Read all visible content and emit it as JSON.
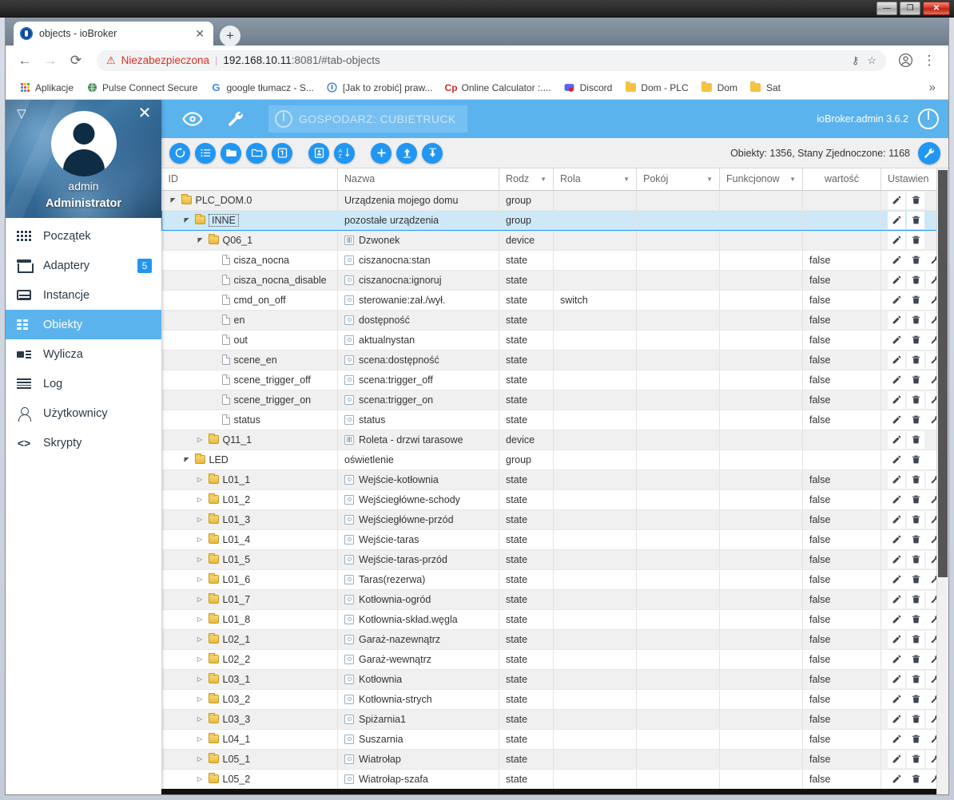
{
  "window": {
    "minimize_label": "—",
    "maximize_label": "❐",
    "close_label": "✕"
  },
  "browser": {
    "tab": {
      "title": "objects - ioBroker",
      "close_label": "✕"
    },
    "new_tab_label": "+",
    "nav": {
      "back": "←",
      "forward": "→",
      "reload": "⟳"
    },
    "omnibox": {
      "warning_icon": "⚠",
      "security_text": "Niezabezpieczona",
      "separator": "|",
      "url_host": "192.168.10.11",
      "url_rest": ":8081/#tab-objects",
      "key_icon": "⚷",
      "star_icon": "☆"
    },
    "profile_icon": "●",
    "menu_icon": "⋮",
    "bookmarks": [
      {
        "label": "Aplikacje",
        "icon": "apps-grid-icon"
      },
      {
        "label": "Pulse Connect Secure",
        "icon": "globe-icon"
      },
      {
        "label": "google tłumacz - S...",
        "icon": "google-icon"
      },
      {
        "label": "[Jak to zrobić] praw...",
        "icon": "info-icon"
      },
      {
        "label": "Online Calculator :....",
        "icon": "calculator-icon"
      },
      {
        "label": "Discord",
        "icon": "discord-icon"
      },
      {
        "label": "Dom - PLC",
        "icon": "folder-icon"
      },
      {
        "label": "Dom",
        "icon": "folder-icon"
      },
      {
        "label": "Sat",
        "icon": "folder-icon"
      }
    ],
    "bookmarks_overflow": "»"
  },
  "sidebar": {
    "caret_icon": "▽",
    "close_icon": "✕",
    "user_name": "admin",
    "user_role": "Administrator",
    "items": [
      {
        "label": "Początek",
        "icon": "apps-icon",
        "badge": "",
        "active": false
      },
      {
        "label": "Adaptery",
        "icon": "store-icon",
        "badge": "5",
        "active": false
      },
      {
        "label": "Instancje",
        "icon": "instances-icon",
        "badge": "",
        "active": false
      },
      {
        "label": "Obiekty",
        "icon": "list-icon",
        "badge": "",
        "active": true
      },
      {
        "label": "Wylicza",
        "icon": "enum-icon",
        "badge": "",
        "active": false
      },
      {
        "label": "Log",
        "icon": "log-icon",
        "badge": "",
        "active": false
      },
      {
        "label": "Użytkownicy",
        "icon": "user-icon",
        "badge": "",
        "active": false
      },
      {
        "label": "Skrypty",
        "icon": "code-icon",
        "badge": "",
        "active": false
      }
    ]
  },
  "appbar": {
    "eye_icon": "eye-icon",
    "wrench_icon": "wrench-icon",
    "host_badge": "GOSPODARZ: CUBIETRUCK",
    "version": "ioBroker.admin 3.6.2",
    "power_icon": "power-icon",
    "accent_color": "#5bb3ee"
  },
  "toolbar": {
    "buttons": [
      {
        "name": "refresh-button",
        "icon": "refresh-icon"
      },
      {
        "name": "expand-list-button",
        "icon": "list-icon"
      },
      {
        "name": "expand-all-button",
        "icon": "folder-filled-icon"
      },
      {
        "name": "collapse-all-button",
        "icon": "folder-outline-icon"
      },
      {
        "name": "expand-level-button",
        "icon": "one-badge-icon"
      },
      {
        "name": "clipboard-button",
        "icon": "clipboard-icon"
      },
      {
        "name": "sort-az-button",
        "icon": "sort-az-icon"
      },
      {
        "name": "add-object-button",
        "icon": "plus-icon"
      },
      {
        "name": "import-button",
        "icon": "upload-icon"
      },
      {
        "name": "export-button",
        "icon": "download-icon"
      }
    ],
    "status_text": "Obiekty: 1356, Stany Zjednoczone: 1168",
    "settings_icon": "wrench-icon"
  },
  "table": {
    "columns": [
      {
        "key": "id",
        "label": "ID",
        "filter": false,
        "align": "left"
      },
      {
        "key": "name",
        "label": "Nazwa",
        "filter": false,
        "align": "left"
      },
      {
        "key": "type",
        "label": "Rodz",
        "filter": true,
        "align": "left"
      },
      {
        "key": "role",
        "label": "Rola",
        "filter": true,
        "align": "left"
      },
      {
        "key": "room",
        "label": "Pokój",
        "filter": true,
        "align": "left"
      },
      {
        "key": "func",
        "label": "Funkcjonow",
        "filter": true,
        "align": "left"
      },
      {
        "key": "value",
        "label": "wartość",
        "filter": false,
        "align": "center"
      },
      {
        "key": "acts",
        "label": "Ustawien",
        "filter": true,
        "align": "left"
      }
    ],
    "action_icons": {
      "edit": "pencil-icon",
      "delete": "trash-icon",
      "config": "wrench-icon"
    },
    "rows": [
      {
        "id": "PLC_DOM.0",
        "indent": 0,
        "expander": "open",
        "icon": "folder",
        "name": "Urządzenia mojego domu",
        "nameIcon": "none",
        "type": "group",
        "role": "",
        "room": "",
        "func": "",
        "value": "",
        "acts": [
          "edit",
          "delete"
        ],
        "selected": false,
        "alt": true
      },
      {
        "id": "INNE",
        "indent": 1,
        "expander": "open",
        "icon": "folder",
        "name": "pozostałe urządzenia",
        "nameIcon": "none",
        "type": "group",
        "role": "",
        "room": "",
        "func": "",
        "value": "",
        "acts": [
          "edit",
          "delete"
        ],
        "selected": true,
        "alt": false
      },
      {
        "id": "Q06_1",
        "indent": 2,
        "expander": "open",
        "icon": "folder",
        "name": "Dzwonek",
        "nameIcon": "device",
        "type": "device",
        "role": "",
        "room": "",
        "func": "",
        "value": "",
        "acts": [
          "edit",
          "delete"
        ],
        "selected": false,
        "alt": true
      },
      {
        "id": "cisza_nocna",
        "indent": 3,
        "expander": "none",
        "icon": "doc",
        "name": "ciszanocna:stan",
        "nameIcon": "state",
        "type": "state",
        "role": "",
        "room": "",
        "func": "",
        "value": "false",
        "acts": [
          "edit",
          "delete",
          "config"
        ],
        "selected": false,
        "alt": false
      },
      {
        "id": "cisza_nocna_disable",
        "indent": 3,
        "expander": "none",
        "icon": "doc",
        "name": "ciszanocna:ignoruj",
        "nameIcon": "state",
        "type": "state",
        "role": "",
        "room": "",
        "func": "",
        "value": "false",
        "acts": [
          "edit",
          "delete",
          "config"
        ],
        "selected": false,
        "alt": true
      },
      {
        "id": "cmd_on_off",
        "indent": 3,
        "expander": "none",
        "icon": "doc",
        "name": "sterowanie:zał./wył.",
        "nameIcon": "state",
        "type": "state",
        "role": "switch",
        "room": "",
        "func": "",
        "value": "false",
        "acts": [
          "edit",
          "delete",
          "config"
        ],
        "selected": false,
        "alt": false
      },
      {
        "id": "en",
        "indent": 3,
        "expander": "none",
        "icon": "doc",
        "name": "dostępność",
        "nameIcon": "state",
        "type": "state",
        "role": "",
        "room": "",
        "func": "",
        "value": "false",
        "acts": [
          "edit",
          "delete",
          "config"
        ],
        "selected": false,
        "alt": true
      },
      {
        "id": "out",
        "indent": 3,
        "expander": "none",
        "icon": "doc",
        "name": "aktualnystan",
        "nameIcon": "state",
        "type": "state",
        "role": "",
        "room": "",
        "func": "",
        "value": "false",
        "acts": [
          "edit",
          "delete",
          "config"
        ],
        "selected": false,
        "alt": false
      },
      {
        "id": "scene_en",
        "indent": 3,
        "expander": "none",
        "icon": "doc",
        "name": "scena:dostępność",
        "nameIcon": "state",
        "type": "state",
        "role": "",
        "room": "",
        "func": "",
        "value": "false",
        "acts": [
          "edit",
          "delete",
          "config"
        ],
        "selected": false,
        "alt": true
      },
      {
        "id": "scene_trigger_off",
        "indent": 3,
        "expander": "none",
        "icon": "doc",
        "name": "scena:trigger_off",
        "nameIcon": "state",
        "type": "state",
        "role": "",
        "room": "",
        "func": "",
        "value": "false",
        "acts": [
          "edit",
          "delete",
          "config"
        ],
        "selected": false,
        "alt": false
      },
      {
        "id": "scene_trigger_on",
        "indent": 3,
        "expander": "none",
        "icon": "doc",
        "name": "scena:trigger_on",
        "nameIcon": "state",
        "type": "state",
        "role": "",
        "room": "",
        "func": "",
        "value": "false",
        "acts": [
          "edit",
          "delete",
          "config"
        ],
        "selected": false,
        "alt": true
      },
      {
        "id": "status",
        "indent": 3,
        "expander": "none",
        "icon": "doc",
        "name": "status",
        "nameIcon": "state",
        "type": "state",
        "role": "",
        "room": "",
        "func": "",
        "value": "false",
        "acts": [
          "edit",
          "delete",
          "config"
        ],
        "selected": false,
        "alt": false
      },
      {
        "id": "Q11_1",
        "indent": 2,
        "expander": "closed",
        "icon": "folder",
        "name": "Roleta - drzwi tarasowe",
        "nameIcon": "device",
        "type": "device",
        "role": "",
        "room": "",
        "func": "",
        "value": "",
        "acts": [
          "edit",
          "delete"
        ],
        "selected": false,
        "alt": true
      },
      {
        "id": "LED",
        "indent": 1,
        "expander": "open",
        "icon": "folder",
        "name": "oświetlenie",
        "nameIcon": "none",
        "type": "group",
        "role": "",
        "room": "",
        "func": "",
        "value": "",
        "acts": [
          "edit",
          "delete"
        ],
        "selected": false,
        "alt": false
      },
      {
        "id": "L01_1",
        "indent": 2,
        "expander": "closed",
        "icon": "folder",
        "name": "Wejście-kotłownia",
        "nameIcon": "state",
        "type": "state",
        "role": "",
        "room": "",
        "func": "",
        "value": "false",
        "acts": [
          "edit",
          "delete",
          "config"
        ],
        "selected": false,
        "alt": true
      },
      {
        "id": "L01_2",
        "indent": 2,
        "expander": "closed",
        "icon": "folder",
        "name": "Wejściegłówne-schody",
        "nameIcon": "state",
        "type": "state",
        "role": "",
        "room": "",
        "func": "",
        "value": "false",
        "acts": [
          "edit",
          "delete",
          "config"
        ],
        "selected": false,
        "alt": false
      },
      {
        "id": "L01_3",
        "indent": 2,
        "expander": "closed",
        "icon": "folder",
        "name": "Wejściegłówne-przód",
        "nameIcon": "state",
        "type": "state",
        "role": "",
        "room": "",
        "func": "",
        "value": "false",
        "acts": [
          "edit",
          "delete",
          "config"
        ],
        "selected": false,
        "alt": true
      },
      {
        "id": "L01_4",
        "indent": 2,
        "expander": "closed",
        "icon": "folder",
        "name": "Wejście-taras",
        "nameIcon": "state",
        "type": "state",
        "role": "",
        "room": "",
        "func": "",
        "value": "false",
        "acts": [
          "edit",
          "delete",
          "config"
        ],
        "selected": false,
        "alt": false
      },
      {
        "id": "L01_5",
        "indent": 2,
        "expander": "closed",
        "icon": "folder",
        "name": "Wejście-taras-przód",
        "nameIcon": "state",
        "type": "state",
        "role": "",
        "room": "",
        "func": "",
        "value": "false",
        "acts": [
          "edit",
          "delete",
          "config"
        ],
        "selected": false,
        "alt": true
      },
      {
        "id": "L01_6",
        "indent": 2,
        "expander": "closed",
        "icon": "folder",
        "name": "Taras(rezerwa)",
        "nameIcon": "state",
        "type": "state",
        "role": "",
        "room": "",
        "func": "",
        "value": "false",
        "acts": [
          "edit",
          "delete",
          "config"
        ],
        "selected": false,
        "alt": false
      },
      {
        "id": "L01_7",
        "indent": 2,
        "expander": "closed",
        "icon": "folder",
        "name": "Kotłownia-ogród",
        "nameIcon": "state",
        "type": "state",
        "role": "",
        "room": "",
        "func": "",
        "value": "false",
        "acts": [
          "edit",
          "delete",
          "config"
        ],
        "selected": false,
        "alt": true
      },
      {
        "id": "L01_8",
        "indent": 2,
        "expander": "closed",
        "icon": "folder",
        "name": "Kotłownia-skład.węgla",
        "nameIcon": "state",
        "type": "state",
        "role": "",
        "room": "",
        "func": "",
        "value": "false",
        "acts": [
          "edit",
          "delete",
          "config"
        ],
        "selected": false,
        "alt": false
      },
      {
        "id": "L02_1",
        "indent": 2,
        "expander": "closed",
        "icon": "folder",
        "name": "Garaż-nazewnątrz",
        "nameIcon": "state",
        "type": "state",
        "role": "",
        "room": "",
        "func": "",
        "value": "false",
        "acts": [
          "edit",
          "delete",
          "config"
        ],
        "selected": false,
        "alt": true
      },
      {
        "id": "L02_2",
        "indent": 2,
        "expander": "closed",
        "icon": "folder",
        "name": "Garaż-wewnątrz",
        "nameIcon": "state",
        "type": "state",
        "role": "",
        "room": "",
        "func": "",
        "value": "false",
        "acts": [
          "edit",
          "delete",
          "config"
        ],
        "selected": false,
        "alt": false
      },
      {
        "id": "L03_1",
        "indent": 2,
        "expander": "closed",
        "icon": "folder",
        "name": "Kotłownia",
        "nameIcon": "state",
        "type": "state",
        "role": "",
        "room": "",
        "func": "",
        "value": "false",
        "acts": [
          "edit",
          "delete",
          "config"
        ],
        "selected": false,
        "alt": true
      },
      {
        "id": "L03_2",
        "indent": 2,
        "expander": "closed",
        "icon": "folder",
        "name": "Kotłownia-strych",
        "nameIcon": "state",
        "type": "state",
        "role": "",
        "room": "",
        "func": "",
        "value": "false",
        "acts": [
          "edit",
          "delete",
          "config"
        ],
        "selected": false,
        "alt": false
      },
      {
        "id": "L03_3",
        "indent": 2,
        "expander": "closed",
        "icon": "folder",
        "name": "Spiżarnia1",
        "nameIcon": "state",
        "type": "state",
        "role": "",
        "room": "",
        "func": "",
        "value": "false",
        "acts": [
          "edit",
          "delete",
          "config"
        ],
        "selected": false,
        "alt": true
      },
      {
        "id": "L04_1",
        "indent": 2,
        "expander": "closed",
        "icon": "folder",
        "name": "Suszarnia",
        "nameIcon": "state",
        "type": "state",
        "role": "",
        "room": "",
        "func": "",
        "value": "false",
        "acts": [
          "edit",
          "delete",
          "config"
        ],
        "selected": false,
        "alt": false
      },
      {
        "id": "L05_1",
        "indent": 2,
        "expander": "closed",
        "icon": "folder",
        "name": "Wiatrołap",
        "nameIcon": "state",
        "type": "state",
        "role": "",
        "room": "",
        "func": "",
        "value": "false",
        "acts": [
          "edit",
          "delete",
          "config"
        ],
        "selected": false,
        "alt": true
      },
      {
        "id": "L05_2",
        "indent": 2,
        "expander": "closed",
        "icon": "folder",
        "name": "Wiatrołap-szafa",
        "nameIcon": "state",
        "type": "state",
        "role": "",
        "room": "",
        "func": "",
        "value": "false",
        "acts": [
          "edit",
          "delete",
          "config"
        ],
        "selected": false,
        "alt": false
      }
    ]
  }
}
